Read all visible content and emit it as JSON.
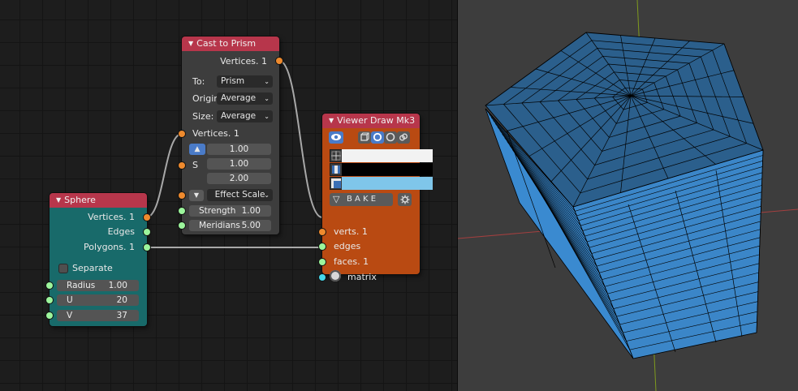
{
  "colors": {
    "editor_bg": "#1d1d1d",
    "sphere_header": "#b7364b",
    "sphere_body": "#186a6a",
    "prism_header": "#b7364b",
    "prism_body": "#3d3d3d",
    "viewer_header": "#b7364b",
    "viewer_body": "#b94a12",
    "socket_vertices": "#ee8a2e",
    "socket_edges_faces": "#9cf59c",
    "socket_matrix": "#46d6e8",
    "link": "#a8a8a8",
    "mesh_face": "#3b86c8",
    "mesh_top": "#2b5f8c",
    "axis_x": "#a33f3f",
    "axis_y": "#7f9a1e",
    "viewport_bg": "#3d3d3d"
  },
  "sphere": {
    "title": "Sphere",
    "out_vertices": "Vertices. 1",
    "out_edges": "Edges",
    "out_polygons": "Polygons. 1",
    "separate_label": "Separate",
    "separate_checked": false,
    "radius_label": "Radius",
    "radius_value": "1.00",
    "u_label": "U",
    "u_value": "20",
    "v_label": "V",
    "v_value": "37"
  },
  "prism": {
    "title": "Cast to Prism",
    "out_vertices": "Vertices. 1",
    "to_label": "To:",
    "to_value": "Prism",
    "origin_label": "Origin",
    "origin_value": "Average",
    "size_label": "Size:",
    "size_value": "Average",
    "in_vertices": "Vertices. 1",
    "s_label": "S",
    "s_x": "1.00",
    "s_y": "1.00",
    "s_z": "2.00",
    "effect_scale": "Effect Scale",
    "strength_label": "Strength",
    "strength_value": "1.00",
    "meridians_label": "Meridians",
    "meridians_value": "5.00"
  },
  "viewer": {
    "title": "Viewer Draw Mk3",
    "bake_label": "B A K E",
    "in_verts": "verts. 1",
    "in_edges": "edges",
    "in_faces": "faces. 1",
    "in_matrix": "matrix",
    "vertex_color": "#f2f2f2",
    "edge_color": "#000000",
    "face_color": "#7fc6ea"
  },
  "viewport": {
    "mesh_rings": 23,
    "mesh_meridians": 5
  }
}
